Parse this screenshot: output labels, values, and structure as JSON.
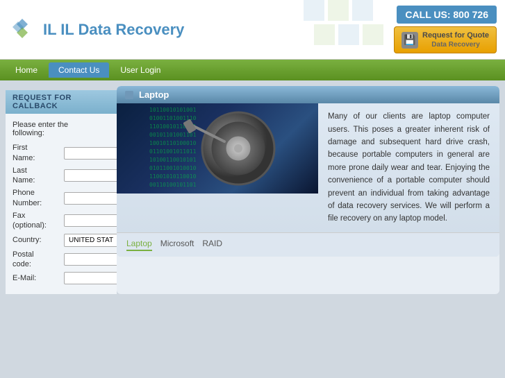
{
  "header": {
    "logo_text": "IL Data Recovery",
    "logo_icon": "⟳",
    "call_us": "CALL US: 800 726",
    "quote_btn_line1": "Request for Quote",
    "quote_btn_line2": "Data Recovery"
  },
  "nav": {
    "items": [
      {
        "label": "Home",
        "active": false
      },
      {
        "label": "Contact Us",
        "active": true
      },
      {
        "label": "User Login",
        "active": false
      }
    ]
  },
  "laptop_card": {
    "tab_label": "Laptop",
    "description": "Many of our clients are laptop computer users. This poses a greater inherent risk of damage and subsequent hard drive crash, because portable computers in general are more prone daily wear and tear. Enjoying the convenience of a portable computer should prevent an individual from taking advantage of data recovery services. We will perform a file recovery on any laptop model.",
    "tabs": [
      {
        "label": "Laptop",
        "active": true
      },
      {
        "label": "Microsoft",
        "active": false
      },
      {
        "label": "RAID",
        "active": false
      }
    ]
  },
  "callback_form": {
    "header": "REQUEST FOR CALLBACK",
    "intro_line1": "Please enter the",
    "intro_line2": "following:",
    "fields": [
      {
        "label_line1": "First",
        "label_line2": "Name:",
        "type": "text",
        "name": "first-name"
      },
      {
        "label_line1": "Last",
        "label_line2": "Name:",
        "type": "text",
        "name": "last-name"
      },
      {
        "label_line1": "Phone",
        "label_line2": "Number:",
        "type": "text",
        "name": "phone"
      },
      {
        "label_line1": "Fax",
        "label_line2": "(optional):",
        "type": "text",
        "name": "fax"
      },
      {
        "label_line1": "Country:",
        "label_line2": "",
        "type": "select",
        "name": "country",
        "value": "UNITED STATE"
      },
      {
        "label_line1": "Postal",
        "label_line2": "code:",
        "type": "text",
        "name": "postal"
      },
      {
        "label_line1": "E-Mail:",
        "label_line2": "",
        "type": "text",
        "name": "email"
      }
    ]
  },
  "binary_data": "10110010101\n01001101001\n11010010110\n00101101001\n10010110100\n01101001011\n10100110010\n01011001010"
}
